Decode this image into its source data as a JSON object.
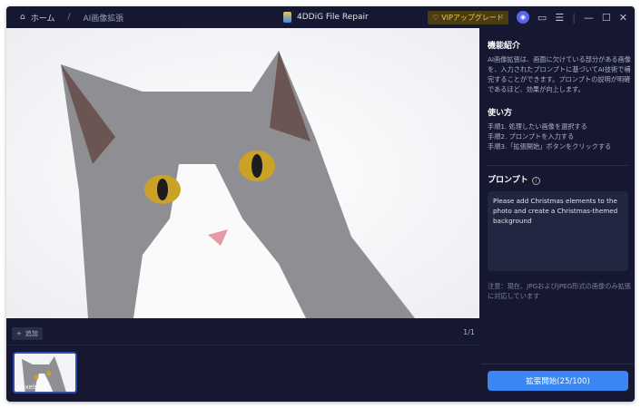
{
  "header": {
    "home": "ホーム",
    "separator": "/",
    "current": "AI画像拡張",
    "app_title": "4DDiG File Repair",
    "vip": "VIPアップグレード"
  },
  "toolbar": {
    "add": "追加",
    "pager": "1/1"
  },
  "thumbnail": {
    "label": "pexels-..."
  },
  "panel": {
    "intro_title": "機能紹介",
    "intro_text": "AI画像拡張は、画面に欠けている部分がある画像を、入力されたプロンプトに基づいてAI技術で補完することができます。プロンプトの説明が明確であるほど、効果が向上します。",
    "howto_title": "使い方",
    "steps": [
      "手順1. 処理したい画像を選択する",
      "手順2. プロンプトを入力する",
      "手順3.「拡張開始」ボタンをクリックする"
    ],
    "prompt_title": "プロンプト",
    "prompt_value": "Please add Christmas elements to the photo and create a Christmas-themed background",
    "note": "注意：現在、JPGおよびJPEG形式の画像のみ拡張に対応しています",
    "start": "拡張開始(25/100)"
  },
  "colors": {
    "accent": "#3a86f5",
    "bg": "#151830",
    "vip": "#f3c44a"
  }
}
